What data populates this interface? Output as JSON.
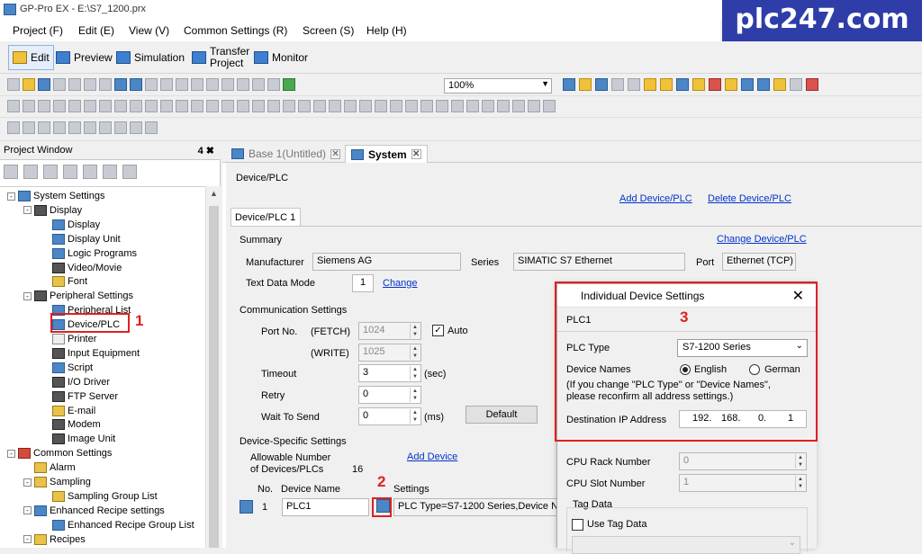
{
  "window": {
    "title": "GP-Pro EX - E:\\S7_1200.prx"
  },
  "watermark": "plc247.com",
  "menu": [
    "Project (F)",
    "Edit (E)",
    "View (V)",
    "Common Settings (R)",
    "Screen (S)",
    "Help (H)"
  ],
  "modes": {
    "edit": "Edit",
    "preview": "Preview",
    "simulation": "Simulation",
    "transfer_line1": "Transfer",
    "transfer_line2": "Project",
    "monitor": "Monitor"
  },
  "zoom": "100%",
  "project_window": {
    "title": "Project Window",
    "pin": "4 ✖",
    "tree": [
      {
        "label": "System Settings",
        "level": 0,
        "expander": "-",
        "icon": "b"
      },
      {
        "label": "Display",
        "level": 1,
        "expander": "-",
        "icon": "k"
      },
      {
        "label": "Display",
        "level": 2,
        "icon": "b"
      },
      {
        "label": "Display Unit",
        "level": 2,
        "icon": "b"
      },
      {
        "label": "Logic Programs",
        "level": 2,
        "icon": "b"
      },
      {
        "label": "Video/Movie",
        "level": 2,
        "icon": "k"
      },
      {
        "label": "Font",
        "level": 2,
        "icon": "y"
      },
      {
        "label": "Peripheral Settings",
        "level": 1,
        "expander": "-",
        "icon": "k"
      },
      {
        "label": "Peripheral List",
        "level": 2,
        "icon": "b"
      },
      {
        "label": "Device/PLC",
        "level": 2,
        "icon": "b"
      },
      {
        "label": "Printer",
        "level": 2,
        "icon": "w"
      },
      {
        "label": "Input Equipment",
        "level": 2,
        "icon": "k"
      },
      {
        "label": "Script",
        "level": 2,
        "icon": "b"
      },
      {
        "label": "I/O Driver",
        "level": 2,
        "icon": "k"
      },
      {
        "label": "FTP Server",
        "level": 2,
        "icon": "k"
      },
      {
        "label": "E-mail",
        "level": 2,
        "icon": "y"
      },
      {
        "label": "Modem",
        "level": 2,
        "icon": "k"
      },
      {
        "label": "Image Unit",
        "level": 2,
        "icon": "k"
      },
      {
        "label": "Common Settings",
        "level": 0,
        "expander": "-",
        "icon": "r"
      },
      {
        "label": "Alarm",
        "level": 1,
        "icon": "y"
      },
      {
        "label": "Sampling",
        "level": 1,
        "expander": "-",
        "icon": "y"
      },
      {
        "label": "Sampling Group List",
        "level": 2,
        "icon": "y"
      },
      {
        "label": "Enhanced Recipe settings",
        "level": 1,
        "expander": "-",
        "icon": "b"
      },
      {
        "label": "Enhanced Recipe Group List",
        "level": 2,
        "icon": "b"
      },
      {
        "label": "Recipes",
        "level": 1,
        "expander": "-",
        "icon": "y"
      }
    ]
  },
  "markers": {
    "one": "1",
    "two": "2",
    "three": "3"
  },
  "tabs": [
    {
      "label": "Base 1(Untitled)",
      "active": false
    },
    {
      "label": "System",
      "active": true
    }
  ],
  "device": {
    "section_title": "Device/PLC",
    "add_link": "Add Device/PLC",
    "delete_link": "Delete Device/PLC",
    "tab": "Device/PLC 1",
    "summary": "Summary",
    "change_link": "Change Device/PLC",
    "manufacturer_label": "Manufacturer",
    "manufacturer": "Siemens AG",
    "series_label": "Series",
    "series": "SIMATIC S7 Ethernet",
    "port_label": "Port",
    "port": "Ethernet (TCP)",
    "text_mode_label": "Text Data Mode",
    "text_mode": "1",
    "text_mode_change": "Change",
    "comm_title": "Communication Settings",
    "port_no_label": "Port No.",
    "fetch_label": "(FETCH)",
    "fetch": "1024",
    "write_label": "(WRITE)",
    "write": "1025",
    "auto_label": "Auto",
    "auto_checked": true,
    "timeout_label": "Timeout",
    "timeout": "3",
    "timeout_unit": "(sec)",
    "retry_label": "Retry",
    "retry": "0",
    "wait_label": "Wait To Send",
    "wait": "0",
    "wait_unit": "(ms)",
    "default_button": "Default",
    "specific_title": "Device-Specific Settings",
    "allowable_line1": "Allowable Number",
    "allowable_line2": "of Devices/PLCs",
    "allowable": "16",
    "add_device": "Add Device",
    "col_no": "No.",
    "col_name": "Device Name",
    "col_settings": "Settings",
    "row_no": "1",
    "row_name": "PLC1",
    "row_settings": "PLC Type=S7-1200 Series,Device Nar"
  },
  "dialog": {
    "title": "Individual Device Settings",
    "close": "✕",
    "device": "PLC1",
    "plc_type_label": "PLC Type",
    "plc_type": "S7-1200 Series",
    "names_label": "Device Names",
    "english": "English",
    "german": "German",
    "note_line1": "(If you change \"PLC Type\" or \"Device Names\",",
    "note_line2": "please reconfirm all address settings.)",
    "ip_label": "Destination IP Address",
    "ip": [
      "192.",
      "168.",
      "0.",
      "1"
    ],
    "rack_label": "CPU Rack Number",
    "rack": "0",
    "slot_label": "CPU Slot Number",
    "slot": "1",
    "tag_data": "Tag Data",
    "use_tag": "Use Tag Data"
  }
}
